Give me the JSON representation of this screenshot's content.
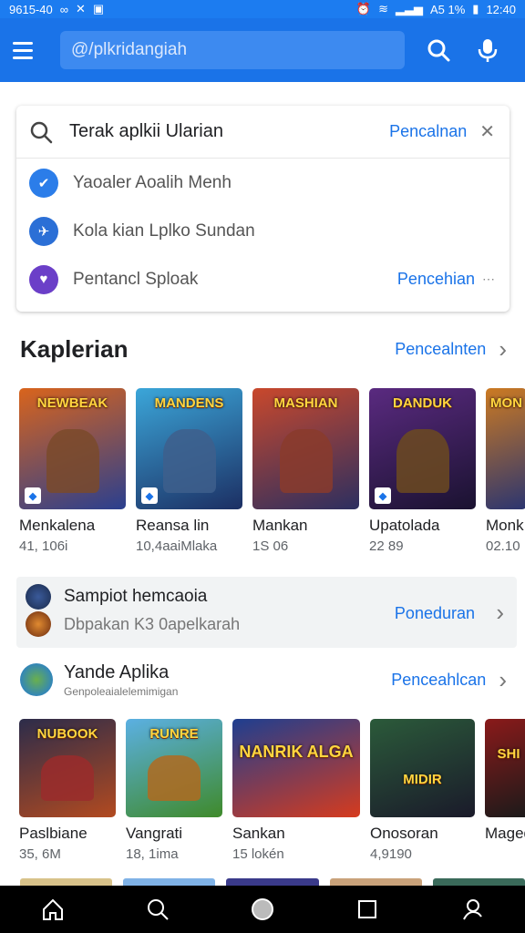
{
  "status_bar": {
    "left_text": "9615-40",
    "right_text": "A5 1%",
    "time": "12:40"
  },
  "app_bar": {
    "search_text": "@/plkridangiah",
    "icons": [
      "menu-icon",
      "search-icon",
      "mic-icon"
    ]
  },
  "suggest_card": {
    "query": "Terak aplkii Ularian",
    "action": "Pencalnan",
    "items": [
      {
        "label": "Yaoaler Aoalih Menh",
        "icon": "check-icon",
        "color": "#2b7de9"
      },
      {
        "label": "Kola kian Lplko Sundan",
        "icon": "plane-icon",
        "color": "#2b6fd6"
      },
      {
        "label": "Pentancl Sploak",
        "icon": "heart-icon",
        "color": "#6b3fc8",
        "action": "Pencehian"
      }
    ]
  },
  "section1": {
    "title": "Kaplerian",
    "action": "Pencealnten",
    "apps": [
      {
        "title_art": "NEWBEAK",
        "name": "Menkalena",
        "meta": "41, 106i",
        "bg1": "#d9641c",
        "bg2": "#2a3f8f",
        "fig": "#7a4a2a"
      },
      {
        "title_art": "MANDENS",
        "name": "Reansa lin",
        "meta": "10,4aaiMlaka",
        "bg1": "#3ba6d9",
        "bg2": "#1c2f63",
        "fig": "#3e5f8c"
      },
      {
        "title_art": "MASHIAN",
        "name": "Mankan",
        "meta": "1S 06",
        "bg1": "#c9482c",
        "bg2": "#2c2f60",
        "fig": "#8a3b2b"
      },
      {
        "title_art": "DANDUK",
        "name": "Upatolada",
        "meta": "22 89",
        "bg1": "#5a2a80",
        "bg2": "#1a1230",
        "fig": "#6c4a20"
      },
      {
        "title_art": "MON",
        "name": "Monk",
        "meta": "02.10",
        "bg1": "#cc7a22",
        "bg2": "#2b3570",
        "fig": "#503080"
      }
    ]
  },
  "promo": {
    "line1": "Sampiot hemcaoia",
    "line2": "Dbpakan K3 0apelkarah",
    "action": "Poneduran"
  },
  "section2": {
    "title": "Yande Aplika",
    "subtitle": "Genpoleaialelemimigan",
    "action": "Penceahlcan",
    "apps": [
      {
        "title_art": "NUBOOK",
        "name": "Paslbiane",
        "meta": "35, 6M",
        "bg1": "#2c2c4a",
        "bg2": "#b24a20",
        "fig": "#9a2c2c"
      },
      {
        "title_art": "RUNRE",
        "name": "Vangrati",
        "meta": "18, 1ima",
        "bg1": "#5bb0e3",
        "bg2": "#3f8a2a",
        "fig": "#b06a20"
      },
      {
        "title_art": "NANRIK ALGA",
        "name": "Sankan",
        "meta": "15 lokén",
        "bg1": "#1e3e90",
        "bg2": "#d63b1e",
        "fig": "#f2c23a"
      },
      {
        "title_art": "MIDIR",
        "name": "Onosoran",
        "meta": "4,9190",
        "bg1": "#2b5a3a",
        "bg2": "#1a1a2a",
        "fig": "#6e3c8c"
      },
      {
        "title_art": "SHI",
        "name": "Maged",
        "meta": "",
        "bg1": "#8a1a1a",
        "bg2": "#1a1a1a",
        "fig": "#d89a20"
      }
    ]
  },
  "nav": [
    "home-icon",
    "search-icon",
    "circle-icon",
    "square-icon",
    "profile-icon"
  ]
}
